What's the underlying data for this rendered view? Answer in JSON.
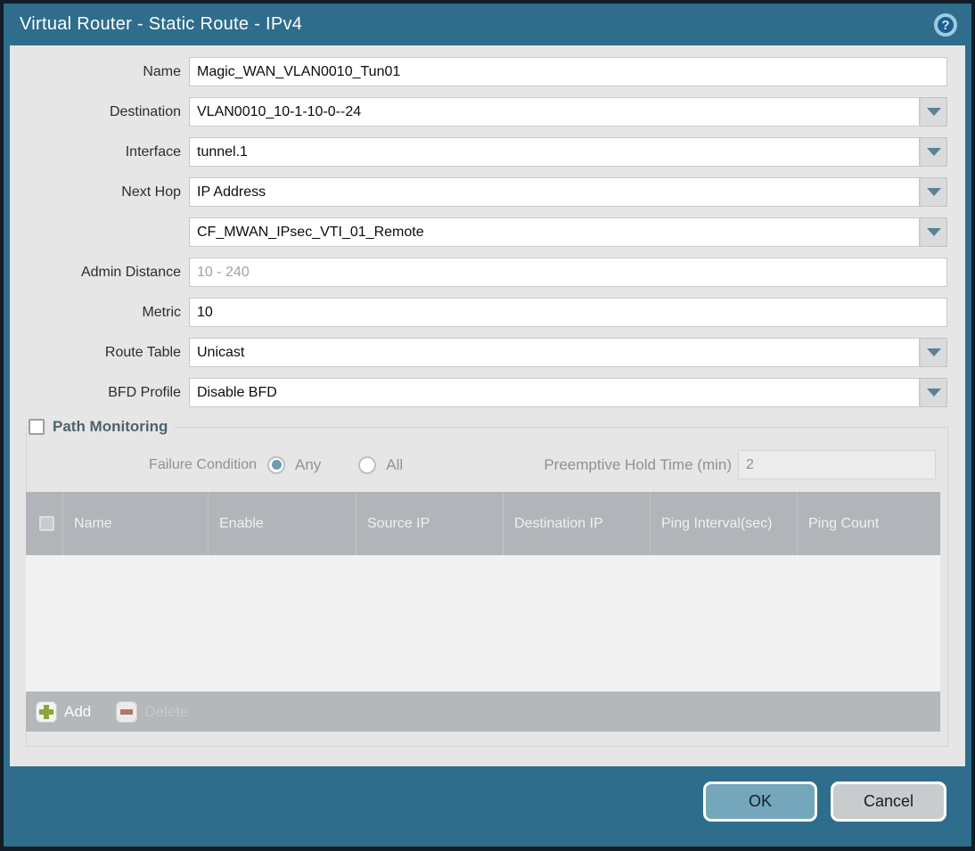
{
  "dialog": {
    "title": "Virtual Router - Static Route - IPv4",
    "help_glyph": "?"
  },
  "fields": {
    "name": {
      "label": "Name",
      "value": "Magic_WAN_VLAN0010_Tun01"
    },
    "destination": {
      "label": "Destination",
      "value": "VLAN0010_10-1-10-0--24"
    },
    "interface": {
      "label": "Interface",
      "value": "tunnel.1"
    },
    "next_hop": {
      "label": "Next Hop",
      "value": "IP Address"
    },
    "next_hop_address": {
      "value": "CF_MWAN_IPsec_VTI_01_Remote"
    },
    "admin_distance": {
      "label": "Admin Distance",
      "placeholder": "10 - 240",
      "value": ""
    },
    "metric": {
      "label": "Metric",
      "value": "10"
    },
    "route_table": {
      "label": "Route Table",
      "value": "Unicast"
    },
    "bfd_profile": {
      "label": "BFD Profile",
      "value": "Disable BFD"
    }
  },
  "path_monitoring": {
    "title": "Path Monitoring",
    "enabled": false,
    "failure_condition": {
      "label": "Failure Condition",
      "options": [
        "Any",
        "All"
      ],
      "selected": "Any"
    },
    "preemptive_hold_time": {
      "label": "Preemptive Hold Time (min)",
      "value": "2"
    },
    "table": {
      "columns": [
        "Name",
        "Enable",
        "Source IP",
        "Destination IP",
        "Ping Interval(sec)",
        "Ping Count"
      ],
      "rows": []
    },
    "add_label": "Add",
    "delete_label": "Delete"
  },
  "footer": {
    "ok_label": "OK",
    "cancel_label": "Cancel"
  },
  "colors": {
    "frame_teal": "#2e6d8c",
    "outer_border": "#131c26",
    "panel_gray": "#e6e6e6",
    "table_header_gray": "#b1b5b9",
    "ok_button": "#74a7bb",
    "cancel_button": "#c9cccd",
    "add_icon_green": "#8da43f",
    "delete_icon_red": "#b0756b",
    "radio_dot_blue": "#6f9dac"
  }
}
